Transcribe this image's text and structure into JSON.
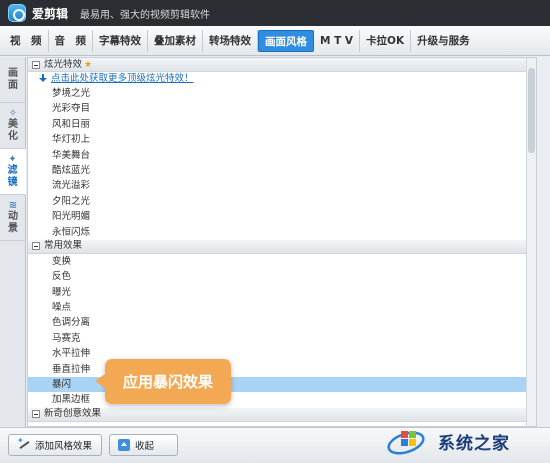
{
  "window": {
    "app_name": "爱剪辑",
    "slogan": "最易用、强大的视频剪辑软件"
  },
  "tabs": [
    {
      "label": "视　频",
      "active": false
    },
    {
      "label": "音　频",
      "active": false
    },
    {
      "label": "字幕特效",
      "active": false
    },
    {
      "label": "叠加素材",
      "active": false
    },
    {
      "label": "转场特效",
      "active": false
    },
    {
      "label": "画面风格",
      "active": true
    },
    {
      "label": "M T V",
      "active": false
    },
    {
      "label": "卡拉OK",
      "active": false
    },
    {
      "label": "升级与服务",
      "active": false
    }
  ],
  "side_tabs": [
    {
      "label": "画面",
      "icon": "image-icon",
      "active": false
    },
    {
      "label": "美化",
      "icon": "beautify-icon",
      "active": false
    },
    {
      "label": "滤镜",
      "icon": "filter-icon",
      "active": true
    },
    {
      "label": "动景",
      "icon": "motion-icon",
      "active": false
    }
  ],
  "groups": {
    "glow": {
      "title": "炫光特效",
      "link": "点击此处获取更多顶级炫光特效！",
      "items": [
        "梦境之光",
        "光彩夺目",
        "风和日丽",
        "华灯初上",
        "华美舞台",
        "酷炫蓝光",
        "流光溢彩",
        "夕阳之光",
        "阳光明媚",
        "永恒闪烁"
      ]
    },
    "common": {
      "title": "常用效果",
      "items": [
        "变换",
        "反色",
        "曝光",
        "噪点",
        "色调分离",
        "马赛克",
        "水平拉伸",
        "垂直拉伸",
        "暴闪",
        "加黑边框"
      ]
    },
    "creative": {
      "title": "新奇创意效果"
    }
  },
  "selected_item": "暴闪",
  "callout": "应用暴闪效果",
  "buttons": {
    "add_style": "添加风格效果",
    "fold": "收起"
  },
  "watermark": {
    "text": "系统之家"
  },
  "colors": {
    "accent": "#2f8ee0",
    "selection": "#a9d3f5",
    "callout": "#f3a953",
    "titlebar": "#2a2d31"
  }
}
